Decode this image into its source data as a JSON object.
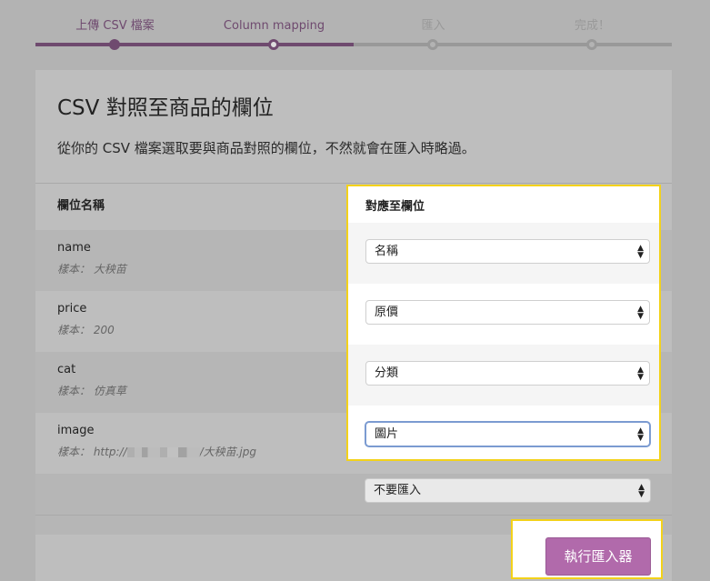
{
  "steps": [
    {
      "label": "上傳 CSV 檔案",
      "state": "done"
    },
    {
      "label": "Column mapping",
      "state": "current"
    },
    {
      "label": "匯入",
      "state": "todo"
    },
    {
      "label": "完成！",
      "state": "todo"
    }
  ],
  "panel": {
    "title": "CSV 對照至商品的欄位",
    "description": "從你的 CSV 檔案選取要與商品對照的欄位，不然就會在匯入時略過。",
    "col_left_header": "欄位名稱",
    "col_right_header": "對應至欄位"
  },
  "rows": [
    {
      "name": "name",
      "sample": "樣本： 大秧苗",
      "mapped": "名稱"
    },
    {
      "name": "price",
      "sample": "樣本： 200",
      "mapped": "原價"
    },
    {
      "name": "cat",
      "sample": "樣本： 仿真草",
      "mapped": "分類"
    },
    {
      "name": "image",
      "sample_prefix": "樣本： http://",
      "sample_suffix": "/大秧苗.jpg",
      "mapped": "圖片"
    }
  ],
  "extra_select": "不要匯入",
  "run_button": "執行匯入器",
  "colors": {
    "accent": "#6f4a6f",
    "button": "#b16aab",
    "highlight": "#f3d21a"
  }
}
